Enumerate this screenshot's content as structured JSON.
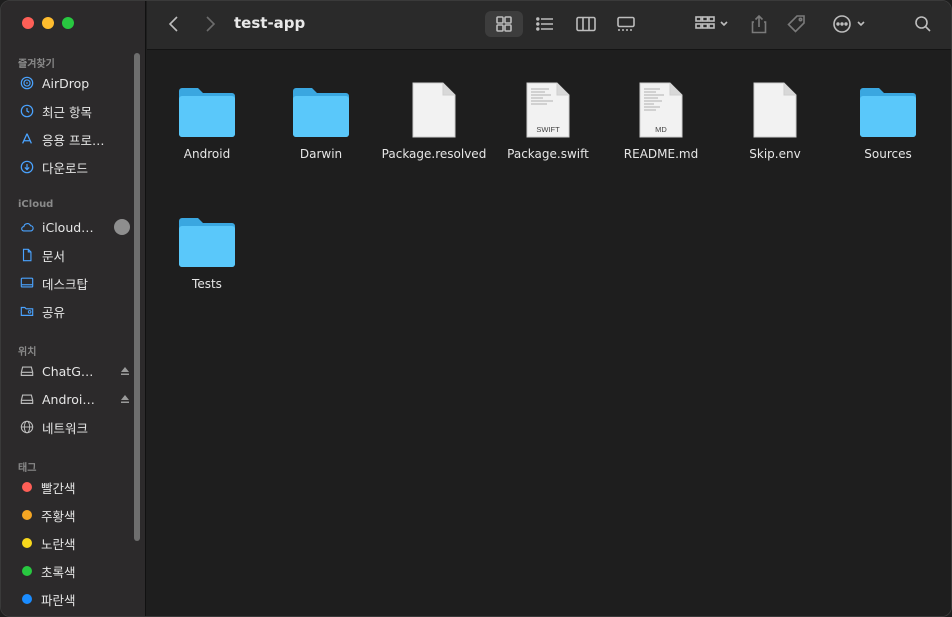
{
  "toolbar": {
    "title": "test-app"
  },
  "sidebar": {
    "sections": {
      "favorites": "즐겨찾기",
      "icloud": "iCloud",
      "locations": "위치",
      "tags": "태그"
    },
    "favorites": [
      {
        "label": "AirDrop",
        "icon": "airdrop-icon"
      },
      {
        "label": "최근 항목",
        "icon": "clock-icon"
      },
      {
        "label": "응용 프로…",
        "icon": "applications-icon"
      },
      {
        "label": "다운로드",
        "icon": "download-icon"
      }
    ],
    "icloud": [
      {
        "label": "iCloud…",
        "icon": "cloud-icon"
      },
      {
        "label": "문서",
        "icon": "document-icon"
      },
      {
        "label": "데스크탑",
        "icon": "desktop-icon"
      },
      {
        "label": "공유",
        "icon": "shared-folder-icon"
      }
    ],
    "locations": [
      {
        "label": "ChatG…",
        "icon": "drive-icon"
      },
      {
        "label": "Androi…",
        "icon": "drive-icon"
      },
      {
        "label": "네트워크",
        "icon": "network-icon"
      }
    ],
    "tags": [
      {
        "label": "빨간색",
        "color": "#ff5f57"
      },
      {
        "label": "주황색",
        "color": "#f5a623"
      },
      {
        "label": "노란색",
        "color": "#f8d81c"
      },
      {
        "label": "초록색",
        "color": "#28c840"
      },
      {
        "label": "파란색",
        "color": "#1a8cff"
      }
    ]
  },
  "files": [
    {
      "name": "Android",
      "kind": "folder"
    },
    {
      "name": "Darwin",
      "kind": "folder"
    },
    {
      "name": "Package.resolved",
      "kind": "document"
    },
    {
      "name": "Package.swift",
      "kind": "document",
      "badge": "SWIFT"
    },
    {
      "name": "README.md",
      "kind": "document",
      "badge": "MD"
    },
    {
      "name": "Skip.env",
      "kind": "document"
    },
    {
      "name": "Sources",
      "kind": "folder"
    },
    {
      "name": "Tests",
      "kind": "folder"
    }
  ],
  "colors": {
    "folder": "#5ac8fa",
    "folder_dark": "#3aa7e0"
  }
}
